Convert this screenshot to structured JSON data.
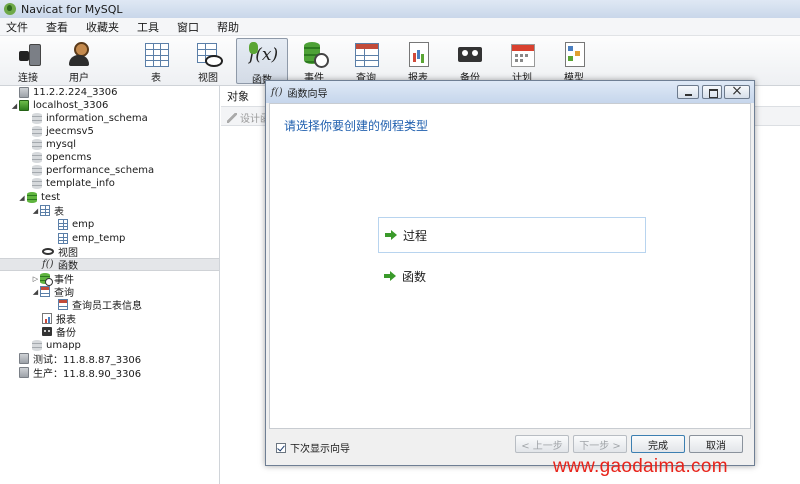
{
  "window": {
    "title": "Navicat for MySQL"
  },
  "menu": [
    "文件",
    "查看",
    "收藏夹",
    "工具",
    "窗口",
    "帮助"
  ],
  "toolbar": [
    {
      "label": "连接",
      "icon": "connection-plug-icon"
    },
    {
      "label": "用户",
      "icon": "user-icon"
    },
    {
      "label": "表",
      "icon": "table-icon"
    },
    {
      "label": "视图",
      "icon": "view-icon"
    },
    {
      "label": "函数",
      "icon": "function-icon",
      "active": true
    },
    {
      "label": "事件",
      "icon": "event-icon"
    },
    {
      "label": "查询",
      "icon": "query-icon"
    },
    {
      "label": "报表",
      "icon": "report-icon"
    },
    {
      "label": "备份",
      "icon": "backup-icon"
    },
    {
      "label": "计划",
      "icon": "schedule-icon"
    },
    {
      "label": "模型",
      "icon": "model-icon"
    }
  ],
  "tree": [
    {
      "label": "11.2.2.224_3306",
      "icon": "server-gray-icon"
    },
    {
      "label": "localhost_3306",
      "icon": "server-green-icon",
      "expanded": true
    },
    {
      "label": "information_schema",
      "icon": "database-gray-icon"
    },
    {
      "label": "jeecmsv5",
      "icon": "database-gray-icon"
    },
    {
      "label": "mysql",
      "icon": "database-gray-icon"
    },
    {
      "label": "opencms",
      "icon": "database-gray-icon"
    },
    {
      "label": "performance_schema",
      "icon": "database-gray-icon"
    },
    {
      "label": "template_info",
      "icon": "database-gray-icon"
    },
    {
      "label": "test",
      "icon": "database-green-icon",
      "expanded": true
    },
    {
      "label": "表",
      "icon": "table-icon",
      "expanded": true
    },
    {
      "label": "emp",
      "icon": "table-icon"
    },
    {
      "label": "emp_temp",
      "icon": "table-icon"
    },
    {
      "label": "视图",
      "icon": "view-icon"
    },
    {
      "label": "函数",
      "icon": "function-icon",
      "selected": true
    },
    {
      "label": "事件",
      "icon": "event-icon"
    },
    {
      "label": "查询",
      "icon": "query-icon",
      "expanded": true
    },
    {
      "label": "查询员工表信息",
      "icon": "query-icon"
    },
    {
      "label": "报表",
      "icon": "report-icon"
    },
    {
      "label": "备份",
      "icon": "backup-icon"
    },
    {
      "label": "umapp",
      "icon": "database-gray-icon"
    },
    {
      "label": "测试：11.8.8.87_3306",
      "icon": "server-gray-icon"
    },
    {
      "label": "生产：11.8.8.90_3306",
      "icon": "server-gray-icon"
    }
  ],
  "main": {
    "object_tab": "对象",
    "design_button": "设计函"
  },
  "dialog": {
    "title": "函数向导",
    "heading": "请选择你要创建的例程类型",
    "options": [
      "过程",
      "函数"
    ],
    "checkbox_label": "下次显示向导",
    "buttons": {
      "prev": "< 上一步",
      "next": "下一步 >",
      "finish": "完成",
      "cancel": "取消"
    }
  },
  "watermark": "www.gaodaima.com",
  "colors": {
    "heading_blue": "#1f5fae",
    "watermark_red": "#e8231a",
    "highlight_border": "#b8d4ef"
  }
}
